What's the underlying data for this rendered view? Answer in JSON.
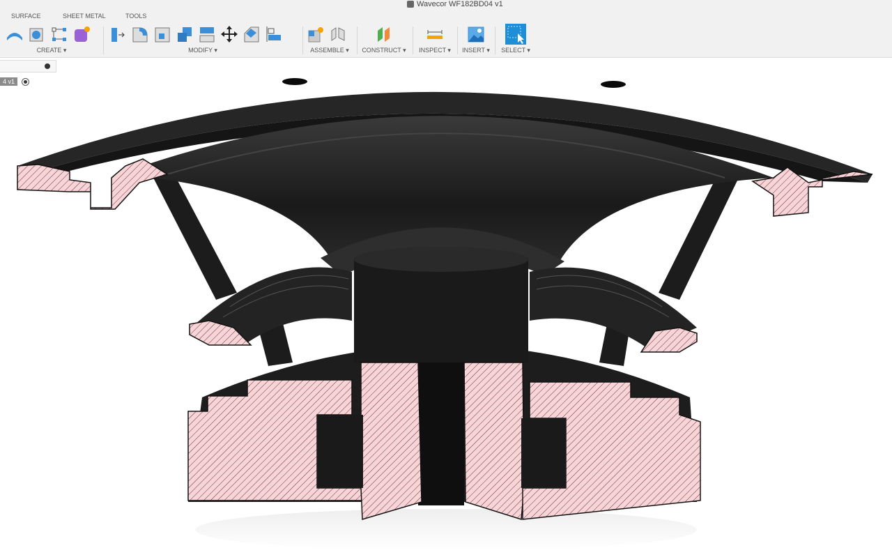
{
  "window": {
    "title": "Wavecor WF182BD04 v1"
  },
  "tabs": [
    "SURFACE",
    "SHEET METAL",
    "TOOLS"
  ],
  "groups": {
    "create": "CREATE ▾",
    "modify": "MODIFY ▾",
    "assemble": "ASSEMBLE ▾",
    "construct": "CONSTRUCT ▾",
    "inspect": "INSPECT ▾",
    "insert": "INSERT ▾",
    "select": "SELECT ▾"
  },
  "browser": {
    "component_label": "4 v1"
  },
  "colors": {
    "section_fill": "#f6d5d8",
    "hatch": "#7a2a30",
    "body": "#1e1e1e",
    "accent": "#1e8fd6"
  }
}
